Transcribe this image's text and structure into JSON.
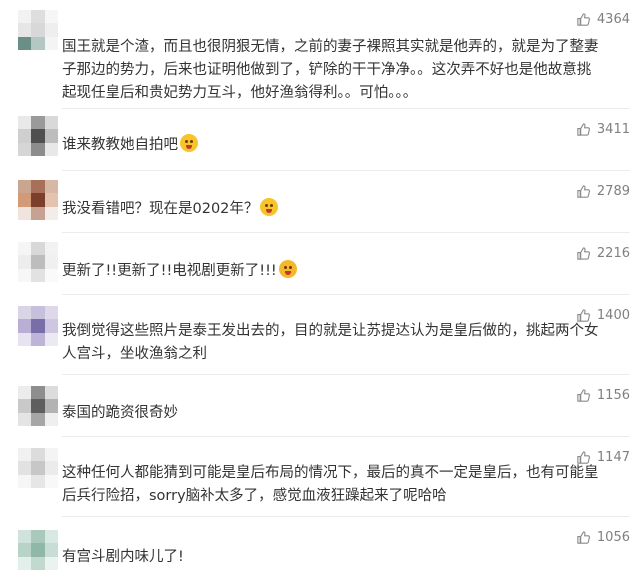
{
  "comments": [
    {
      "text": "国王就是个渣，而且也很阴狠无情，之前的妻子裸照其实就是他弄的，就是为了整妻子那边的势力，后来也证明他做到了，铲除的干干净净。。这次弄不好也是他故意挑起现任皇后和贵妃势力互斗，他好渔翁得利。。可怕。。。",
      "likes": "4364",
      "emoji": "",
      "avatar_colors": [
        "#f2f2f2",
        "#dedede",
        "#f6f6f6",
        "#e6e6e6",
        "#d8d8d8",
        "#eeeeee",
        "#6a8f87",
        "#b5c7c3",
        "#f4f4f4"
      ]
    },
    {
      "text": "谁来教教她自拍吧",
      "likes": "3411",
      "emoji": "flushed-emoji",
      "avatar_colors": [
        "#e9e9e9",
        "#9a9a9a",
        "#d9d9d9",
        "#cfcfcf",
        "#4f4f4f",
        "#bdbdbd",
        "#d6d6d6",
        "#8c8c8c",
        "#e8e8e8"
      ]
    },
    {
      "text": "我没看错吧？现在是0202年？",
      "likes": "2789",
      "emoji": "flushed-emoji",
      "avatar_colors": [
        "#caa590",
        "#a8705a",
        "#d7b7a5",
        "#d29a76",
        "#7c3f2c",
        "#e4c2ad",
        "#efe4de",
        "#c7a191",
        "#f3ece8"
      ]
    },
    {
      "text": "更新了!!更新了!!电视剧更新了!!!",
      "likes": "2216",
      "emoji": "dizzy-emoji",
      "avatar_colors": [
        "#f5f5f5",
        "#d8d8d8",
        "#f2f2f2",
        "#ededed",
        "#bdbdbd",
        "#f0f0f0",
        "#f7f7f7",
        "#e2e2e2",
        "#fafafa"
      ]
    },
    {
      "text": "我倒觉得这些照片是泰王发出去的，目的就是让苏提达认为是皇后做的，挑起两个女人宫斗，坐收渔翁之利",
      "likes": "1400",
      "emoji": "",
      "avatar_colors": [
        "#d9d5e6",
        "#c6c0dc",
        "#ded8ea",
        "#b9aed4",
        "#7a6ea8",
        "#cfc6e2",
        "#e7e3f0",
        "#bdb4d7",
        "#ece9f3"
      ]
    },
    {
      "text": "泰国的跪资很奇妙",
      "likes": "1156",
      "emoji": "",
      "avatar_colors": [
        "#ececec",
        "#8e8e8e",
        "#dcdcdc",
        "#c9c9c9",
        "#5e5e5e",
        "#b3b3b3",
        "#e4e4e4",
        "#a6a6a6",
        "#efefef"
      ]
    },
    {
      "text": "这种任何人都能猜到可能是皇后布局的情况下，最后的真不一定是皇后，也有可能皇后兵行险招，sorry脑补太多了，感觉血液狂躁起来了呢哈哈",
      "likes": "1147",
      "emoji": "",
      "avatar_colors": [
        "#f1f1f1",
        "#dcdcdc",
        "#f4f4f4",
        "#e2e2e2",
        "#c7c7c7",
        "#ebebeb",
        "#f6f6f6",
        "#e6e6e6",
        "#f8f8f8"
      ]
    },
    {
      "text": "有宫斗剧内味儿了!",
      "likes": "1056",
      "emoji": "",
      "avatar_colors": [
        "#cfe3dc",
        "#a9c9bd",
        "#d8e8e2",
        "#b8d4c9",
        "#8fb8a8",
        "#c7ddd5",
        "#e3efea",
        "#c1d9cf",
        "#eaf3ef"
      ]
    }
  ]
}
